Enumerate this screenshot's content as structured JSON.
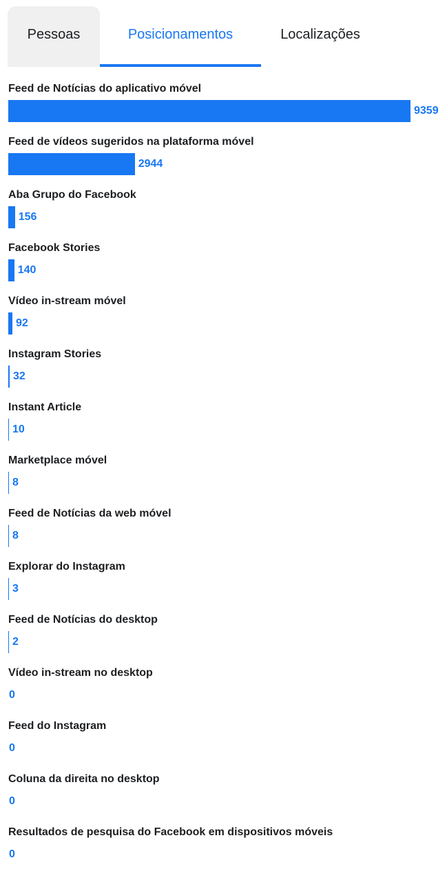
{
  "tabs": {
    "people": "Pessoas",
    "placements": "Posicionamentos",
    "locations": "Localizações"
  },
  "colors": {
    "accent": "#1877f2",
    "inactive_tab_bg": "#f0f0f0"
  },
  "chart_data": {
    "type": "bar",
    "categories": [
      "Feed de Notícias do aplicativo móvel",
      "Feed de vídeos sugeridos na plataforma móvel",
      "Aba Grupo do Facebook",
      "Facebook Stories",
      "Vídeo in-stream móvel",
      "Instagram Stories",
      "Instant Article",
      "Marketplace móvel",
      "Feed de Notícias da web móvel",
      "Explorar do Instagram",
      "Feed de Notícias do desktop",
      "Vídeo in-stream no desktop",
      "Feed do Instagram",
      "Coluna da direita no desktop",
      "Resultados de pesquisa do Facebook em dispositivos móveis"
    ],
    "values": [
      9359,
      2944,
      156,
      140,
      92,
      32,
      10,
      8,
      8,
      3,
      2,
      0,
      0,
      0,
      0
    ],
    "labels": [
      "9359",
      "2944",
      "156",
      "140",
      "92",
      "32",
      "10",
      "8",
      "8",
      "3",
      "2",
      "0",
      "0",
      "0",
      "0"
    ]
  }
}
